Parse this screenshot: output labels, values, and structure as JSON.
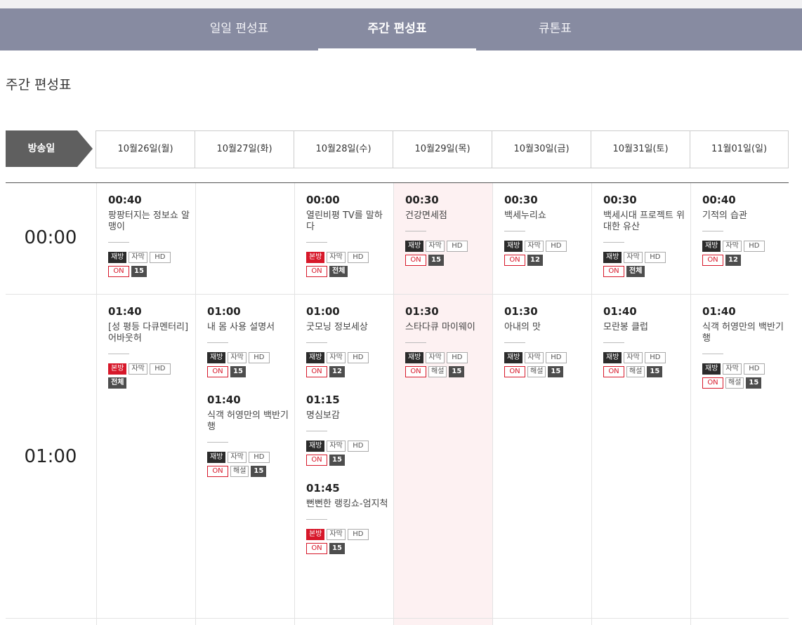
{
  "tabs": [
    {
      "label": "일일 편성표",
      "active": false
    },
    {
      "label": "주간 편성표",
      "active": true
    },
    {
      "label": "큐톤표",
      "active": false
    }
  ],
  "page_title": "주간 편성표",
  "date_header_label": "방송일",
  "dates": [
    "10월26일(월)",
    "10월27일(화)",
    "10월28일(수)",
    "10월29일(목)",
    "10월30일(금)",
    "10월31일(토)",
    "11월01일(일)"
  ],
  "hours": [
    "00:00",
    "01:00"
  ],
  "badge_labels": {
    "rerun": "재방",
    "first": "본방",
    "sub": "자막",
    "hd": "HD",
    "on": "ON",
    "desc": "해설"
  },
  "colors": {
    "tabbar": "#878ba1",
    "first_run": "#d7182a",
    "rerun": "#2b2b2b",
    "highlight": "#fdf1f2"
  },
  "schedule": [
    [
      [
        {
          "time": "00:40",
          "title": "팡팡터지는 정보쇼 알맹이",
          "type": "rerun",
          "desc": false,
          "age": "15"
        }
      ],
      [],
      [
        {
          "time": "00:00",
          "title": "열린비평 TV를 말하다",
          "type": "first",
          "desc": false,
          "age": "전체"
        }
      ],
      [
        {
          "time": "00:30",
          "title": "건강면세점",
          "type": "rerun",
          "desc": false,
          "age": "15"
        }
      ],
      [
        {
          "time": "00:30",
          "title": "백세누리쇼",
          "type": "rerun",
          "desc": false,
          "age": "12"
        }
      ],
      [
        {
          "time": "00:30",
          "title": "백세시대 프로젝트 위대한 유산",
          "type": "rerun",
          "desc": false,
          "age": "전체"
        }
      ],
      [
        {
          "time": "00:40",
          "title": "기적의 습관",
          "type": "rerun",
          "desc": false,
          "age": "12"
        }
      ]
    ],
    [
      [
        {
          "time": "01:40",
          "title": "[성 평등 다큐멘터리] 어바웃허",
          "type": "first",
          "desc": false,
          "age": "전체",
          "noon": true
        }
      ],
      [
        {
          "time": "01:00",
          "title": "내 몸 사용 설명서",
          "type": "rerun",
          "desc": false,
          "age": "15"
        },
        {
          "time": "01:40",
          "title": "식객 허영만의 백반기행",
          "type": "rerun",
          "desc": true,
          "age": "15"
        }
      ],
      [
        {
          "time": "01:00",
          "title": "굿모닝 정보세상",
          "type": "rerun",
          "desc": false,
          "age": "12"
        },
        {
          "time": "01:15",
          "title": "명심보감",
          "type": "rerun",
          "desc": false,
          "age": "15"
        },
        {
          "time": "01:45",
          "title": "뻔뻔한 랭킹쇼-엄지척",
          "type": "first",
          "desc": false,
          "age": "15"
        }
      ],
      [
        {
          "time": "01:30",
          "title": "스타다큐 마이웨이",
          "type": "rerun",
          "desc": true,
          "age": "15"
        }
      ],
      [
        {
          "time": "01:30",
          "title": "아내의 맛",
          "type": "rerun",
          "desc": true,
          "age": "15"
        }
      ],
      [
        {
          "time": "01:40",
          "title": "모란봉 클럽",
          "type": "rerun",
          "desc": true,
          "age": "15"
        }
      ],
      [
        {
          "time": "01:40",
          "title": "식객 허영만의 백반기행",
          "type": "rerun",
          "desc": true,
          "age": "15"
        }
      ]
    ]
  ]
}
